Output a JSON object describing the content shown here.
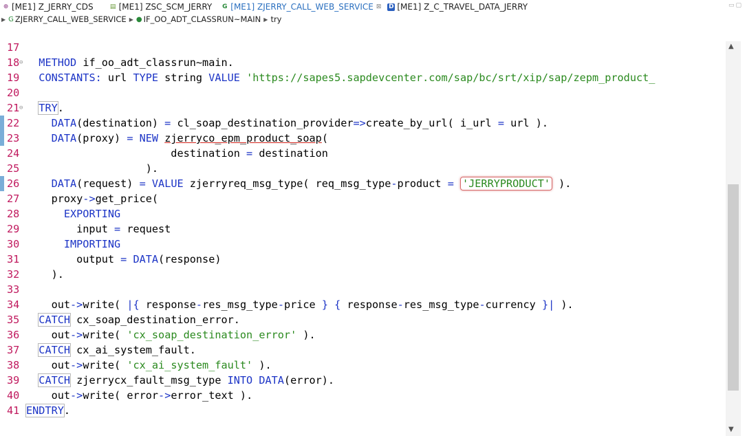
{
  "tabs": [
    {
      "label": "[ME1] Z_JERRY_CDS",
      "icon": "cds-icon",
      "color": "#a15b9a",
      "active": false
    },
    {
      "label": "[ME1] ZSC_SCM_JERRY",
      "icon": "program-icon",
      "color": "#6a9a3a",
      "active": false
    },
    {
      "label": "[ME1] ZJERRY_CALL_WEB_SERVICE",
      "icon": "class-icon",
      "color": "#2a8a3a",
      "active": true
    },
    {
      "label": "[ME1] Z_C_TRAVEL_DATA_JERRY",
      "icon": "data-definition-icon",
      "color": "#2a5fbf",
      "active": false
    }
  ],
  "breadcrumb": {
    "class": "ZJERRY_CALL_WEB_SERVICE",
    "method": "IF_OO_ADT_CLASSRUN~MAIN",
    "block": "try"
  },
  "code": {
    "highlight_value": "'JERRYPRODUCT'",
    "lines": [
      {
        "n": "17"
      },
      {
        "n": "18",
        "fold": true
      },
      {
        "n": "19"
      },
      {
        "n": "20"
      },
      {
        "n": "21",
        "fold": true
      },
      {
        "n": "22",
        "marked": true
      },
      {
        "n": "23",
        "marked": true
      },
      {
        "n": "24"
      },
      {
        "n": "25"
      },
      {
        "n": "26",
        "marked": true
      },
      {
        "n": "27"
      },
      {
        "n": "28"
      },
      {
        "n": "29"
      },
      {
        "n": "30"
      },
      {
        "n": "31"
      },
      {
        "n": "32"
      },
      {
        "n": "33"
      },
      {
        "n": "34"
      },
      {
        "n": "35"
      },
      {
        "n": "36"
      },
      {
        "n": "37"
      },
      {
        "n": "38"
      },
      {
        "n": "39"
      },
      {
        "n": "40"
      },
      {
        "n": "41"
      }
    ]
  },
  "colors": {
    "keyword": "#1c34c6",
    "string": "#2b8a1f",
    "line_number": "#c0195e"
  }
}
